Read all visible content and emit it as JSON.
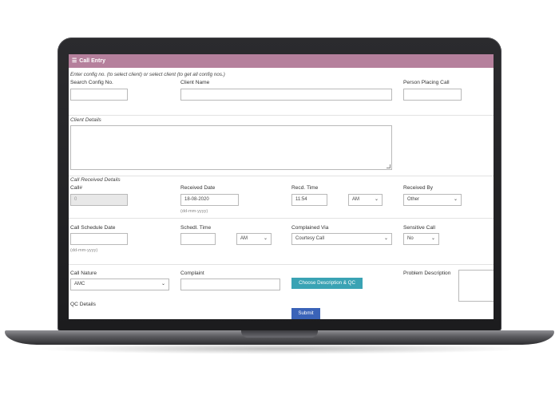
{
  "window": {
    "title": "Call Entry",
    "menu_icon": "hamburger-icon"
  },
  "instructions": "Enter config no. (to select client) or select client (to get all config nos.)",
  "row1": {
    "search_config_label": "Search Config No.",
    "search_config_value": "",
    "client_name_label": "Client Name",
    "client_name_value": "",
    "person_placing_call_label": "Person Placing Call",
    "person_placing_call_value": ""
  },
  "client_details": {
    "label": "Client Details",
    "value": ""
  },
  "call_received": {
    "section_label": "Call Received Details",
    "call_no_label": "Call#",
    "call_no_value": "0",
    "received_date_label": "Received Date",
    "received_date_value": "18-08-2020",
    "received_date_format": "(dd-mm-yyyy)",
    "recd_time_label": "Recd. Time",
    "recd_time_value": "11:54",
    "recd_ampm_value": "AM",
    "received_by_label": "Received By",
    "received_by_value": "Other"
  },
  "schedule": {
    "call_schedule_date_label": "Call Schedule Date",
    "call_schedule_date_value": "",
    "call_schedule_date_format": "(dd-mm-yyyy)",
    "schedl_time_label": "Schedl. Time",
    "schedl_time_value": "",
    "schedl_ampm_value": "AM",
    "complained_via_label": "Complained Via",
    "complained_via_value": "Courtesy Call",
    "sensitive_call_label": "Sensitive Call",
    "sensitive_call_value": "No"
  },
  "nature": {
    "call_nature_label": "Call Nature",
    "call_nature_value": "AMC",
    "complaint_label": "Complaint",
    "complaint_value": "",
    "choose_button_label": "Choose Description & QC",
    "problem_description_label": "Problem Description",
    "problem_description_value": ""
  },
  "qc": {
    "label": "QC Details"
  },
  "submit_label": "Submit"
}
